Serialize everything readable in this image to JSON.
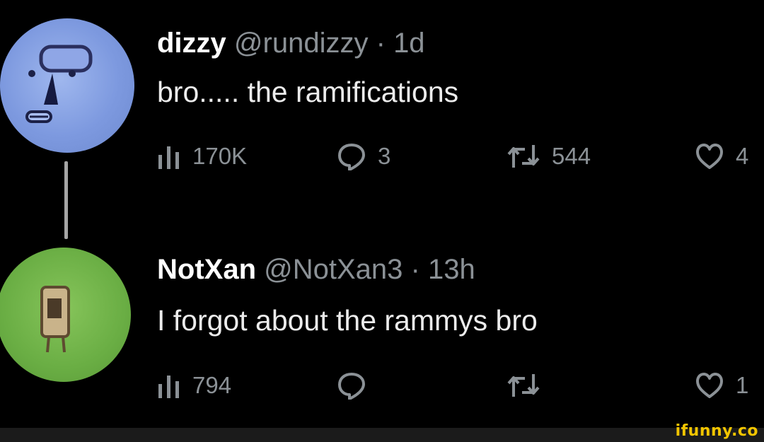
{
  "tweets": [
    {
      "name": "dizzy",
      "handle": "@rundizzy",
      "separator": "·",
      "time": "1d",
      "text": "bro..... the ramifications",
      "views": "170K",
      "replies": "3",
      "retweets": "544",
      "likes": "4"
    },
    {
      "name": "NotXan",
      "handle": "@NotXan3",
      "separator": "·",
      "time": "13h",
      "text": "I forgot about the rammys bro",
      "views": "794",
      "replies": "",
      "retweets": "",
      "likes": "1"
    }
  ],
  "icons": {
    "views": "bar-chart-icon",
    "reply": "speech-bubble-icon",
    "retweet": "retweet-arrows-icon",
    "like": "heart-icon"
  },
  "colors": {
    "background": "#000000",
    "text": "#e7e9ea",
    "muted": "#8b9196",
    "thread_line": "#a6a6a6",
    "watermark": "#f2c500"
  },
  "watermark": "ifunny.co"
}
